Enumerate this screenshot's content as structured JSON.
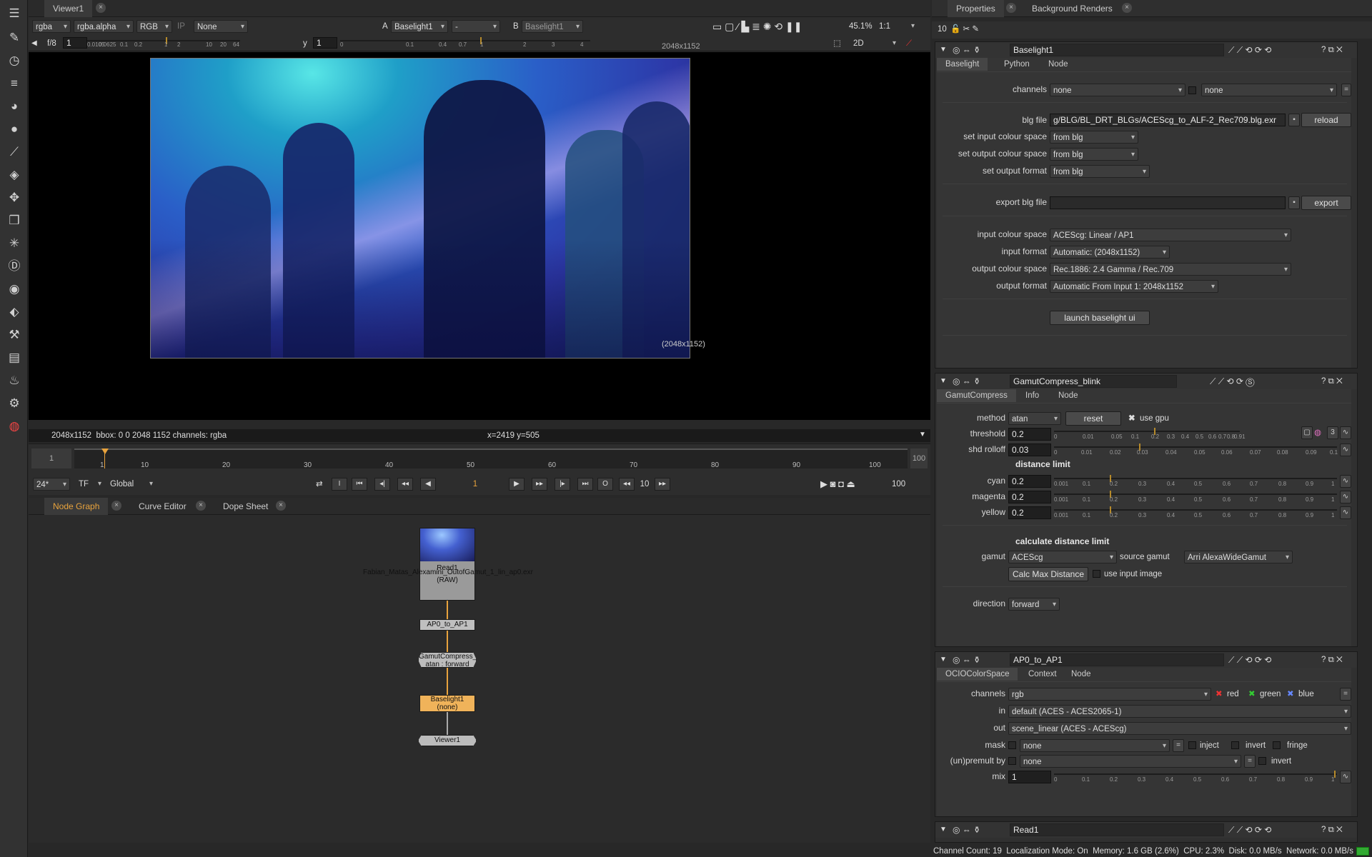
{
  "left_tools": [
    "grid-icon",
    "pen-icon",
    "clock-icon",
    "menu-icon",
    "palette-icon",
    "circle-icon",
    "brush-icon",
    "layers-icon",
    "move-icon",
    "cube-icon",
    "sparkle-icon",
    "d-icon",
    "eye-icon",
    "tag-icon",
    "wrench-icon",
    "film-icon",
    "flame-icon",
    "gear-icon",
    "color-wheel-icon"
  ],
  "viewer": {
    "tab": "Viewer1",
    "channels": "rgba",
    "alpha": "rgba.alpha",
    "colorspace": "RGB",
    "ip": "IP",
    "lut": "None",
    "a_label": "A",
    "a_input": "Baselight1",
    "mode": "-",
    "b_label": "B",
    "b_input": "Baselight1",
    "zoom": "45.1%",
    "ratio": "1:1",
    "fstop": "f/8",
    "gain": "1",
    "y_label": "y",
    "gamma": "1",
    "view_mode": "2D",
    "gain_ticks": [
      "0.0105",
      "0.0625",
      "0.1",
      "0.2",
      "1",
      "2",
      "10",
      "20",
      "64"
    ],
    "gamma_ticks": [
      "0",
      "0.1",
      "0.4",
      "0.7",
      "1",
      "2",
      "3",
      "4"
    ],
    "format_tr": "2048x1152",
    "format_br": "(2048x1152)",
    "status_left": "2048x1152  bbox: 0 0 2048 1152 channels: rgba",
    "status_mid": "x=2419 y=505"
  },
  "timeline": {
    "start": "1",
    "end": "100",
    "ticks": [
      "1",
      "10",
      "20",
      "30",
      "40",
      "50",
      "60",
      "70",
      "80",
      "90",
      "100"
    ],
    "fps": "24*",
    "tf": "TF",
    "global": "Global",
    "frame": "1",
    "step": "10",
    "end_frame": "100",
    "in_label": "I",
    "out_label": "O"
  },
  "graph_tabs": [
    "Node Graph",
    "Curve Editor",
    "Dope Sheet"
  ],
  "nodes": {
    "read_title": "Read1",
    "read_file": "Fabian_Matas_Alexamini_OutofGamut_1_lin_ap0.exr",
    "read_raw": "(RAW)",
    "ap0": "AP0_to_AP1",
    "gamut_title": "GamutCompress_blink",
    "gamut_sub": "atan : forward",
    "baselight_title": "Baselight1",
    "baselight_sub": "(none)",
    "viewer": "Viewer1"
  },
  "props": {
    "tabs": [
      "Properties",
      "Background Renders"
    ],
    "max_panels": "10"
  },
  "baselight": {
    "name": "Baselight1",
    "tabs": [
      "Baselight",
      "Python",
      "Node"
    ],
    "channels_label": "channels",
    "channels": "none",
    "channels2": "none",
    "blg_file_label": "blg file",
    "blg_file": "g/BLG/BL_DRT_BLGs/ACEScg_to_ALF-2_Rec709.blg.exr",
    "reload": "reload",
    "in_cs_label": "set input colour space",
    "in_cs": "from blg",
    "out_cs_label": "set output colour space",
    "out_cs": "from blg",
    "out_fmt_label": "set output format",
    "out_fmt": "from blg",
    "export_label": "export blg file",
    "export": "export",
    "input_cs_label": "input colour space",
    "input_cs": "ACEScg: Linear / AP1",
    "input_fmt_label": "input format",
    "input_fmt": "Automatic: (2048x1152)",
    "output_cs_label": "output colour space",
    "output_cs": "Rec.1886: 2.4 Gamma / Rec.709",
    "output_fmt_label": "output format",
    "output_fmt": "Automatic From Input 1: 2048x1152",
    "launch": "launch baselight ui"
  },
  "gamut": {
    "name": "GamutCompress_blink",
    "tabs": [
      "GamutCompress",
      "Info",
      "Node"
    ],
    "method_label": "method",
    "method": "atan",
    "reset": "reset",
    "use_gpu": "use gpu",
    "threshold_label": "threshold",
    "threshold": "0.2",
    "shd_label": "shd rolloff",
    "shd": "0.03",
    "distance_title": "distance limit",
    "cyan_label": "cyan",
    "cyan": "0.2",
    "magenta_label": "magenta",
    "magenta": "0.2",
    "yellow_label": "yellow",
    "yellow": "0.2",
    "calc_title": "calculate distance limit",
    "gamut_label": "gamut",
    "gamut": "ACEScg",
    "source_label": "source gamut",
    "source": "Arri AlexaWideGamut",
    "calc_btn": "Calc Max Distance",
    "use_input": "use input image",
    "direction_label": "direction",
    "direction": "forward",
    "channel_count": "3",
    "threshold_ticks": [
      "0",
      "0.01",
      "0.05",
      "0.1",
      "0.2",
      "0.3",
      "0.4",
      "0.5",
      "0.6",
      "0.7",
      "0.8",
      "0.91"
    ],
    "shd_ticks": [
      "0",
      "0.01",
      "0.02",
      "0.03",
      "0.04",
      "0.05",
      "0.06",
      "0.07",
      "0.08",
      "0.09",
      "0.1"
    ],
    "limit_ticks": [
      "0.001",
      "0.1",
      "0.2",
      "0.3",
      "0.4",
      "0.5",
      "0.6",
      "0.7",
      "0.8",
      "0.9",
      "1"
    ]
  },
  "ocio": {
    "name": "AP0_to_AP1",
    "tabs": [
      "OCIOColorSpace",
      "Context",
      "Node"
    ],
    "channels_label": "channels",
    "channels": "rgb",
    "red": "red",
    "green": "green",
    "blue": "blue",
    "in_label": "in",
    "in": "default (ACES - ACES2065-1)",
    "out_label": "out",
    "out": "scene_linear (ACES - ACEScg)",
    "mask_label": "mask",
    "mask": "none",
    "inject": "inject",
    "invert": "invert",
    "fringe": "fringe",
    "premult_label": "(un)premult by",
    "premult": "none",
    "invert2": "invert",
    "mix_label": "mix",
    "mix": "1",
    "mix_ticks": [
      "0",
      "0.1",
      "0.2",
      "0.3",
      "0.4",
      "0.5",
      "0.6",
      "0.7",
      "0.8",
      "0.9",
      "1"
    ]
  },
  "read": {
    "name": "Read1"
  },
  "status_bar": "Channel Count: 19  Localization Mode: On  Memory: 1.6 GB (2.6%)  CPU: 2.3%  Disk: 0.0 MB/s  Network: 0.0 MB/s",
  "colors": {
    "accent": "#e8a33d",
    "panel": "#303030",
    "input": "#1f1f1f"
  }
}
